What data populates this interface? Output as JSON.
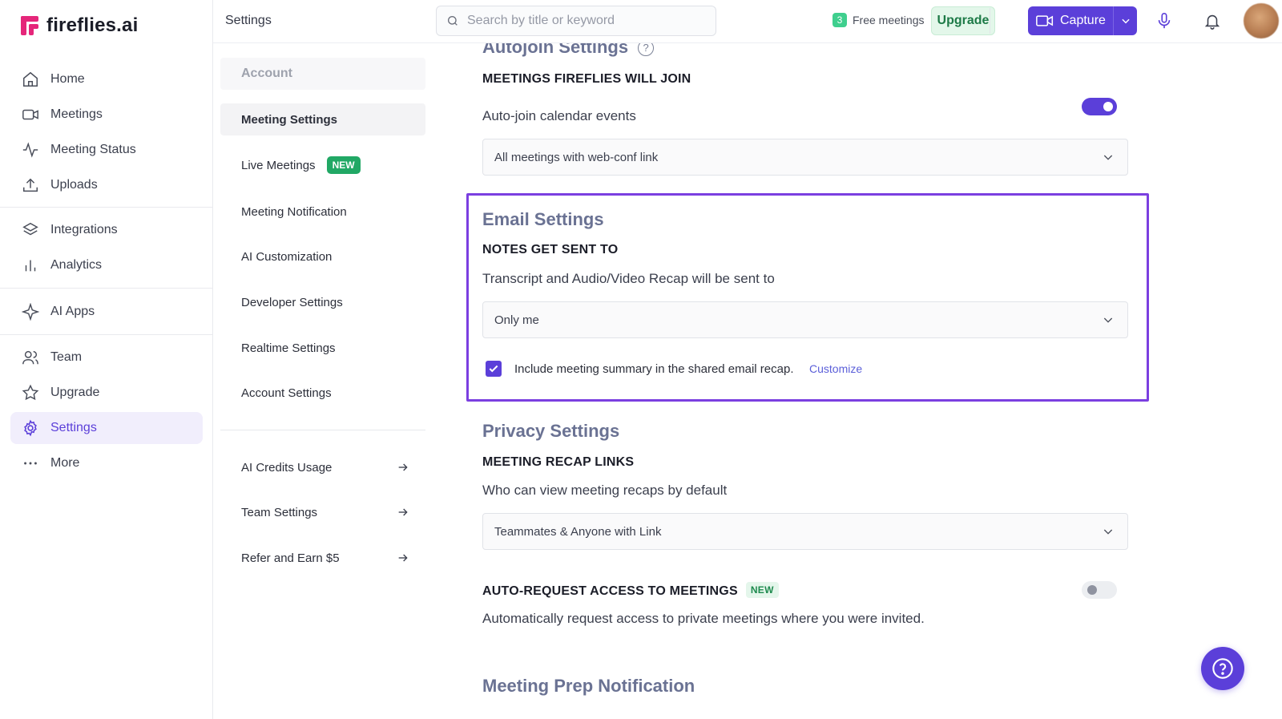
{
  "brand": {
    "name": "fireflies.ai",
    "logo_color": "#e5267a",
    "accent": "#5b3fd9"
  },
  "sidebar": {
    "items": [
      {
        "label": "Home",
        "icon": "home-icon"
      },
      {
        "label": "Meetings",
        "icon": "video-icon"
      },
      {
        "label": "Meeting Status",
        "icon": "pulse-icon"
      },
      {
        "label": "Uploads",
        "icon": "upload-icon"
      },
      {
        "label": "Integrations",
        "icon": "layers-icon"
      },
      {
        "label": "Analytics",
        "icon": "bar-chart-icon"
      },
      {
        "label": "AI Apps",
        "icon": "sparkle-icon"
      },
      {
        "label": "Team",
        "icon": "users-icon"
      },
      {
        "label": "Upgrade",
        "icon": "star-icon"
      },
      {
        "label": "Settings",
        "icon": "gear-icon",
        "active": true
      },
      {
        "label": "More",
        "icon": "more-dots-icon"
      }
    ]
  },
  "topbar": {
    "title": "Settings",
    "search_placeholder": "Search by title or keyword",
    "free_count": "3",
    "free_label": "Free meetings",
    "upgrade_label": "Upgrade",
    "capture_label": "Capture"
  },
  "subnav": {
    "account_header": "Account",
    "items": [
      {
        "label": "Meeting Settings",
        "active": true
      },
      {
        "label": "Live Meetings",
        "badge": "NEW"
      },
      {
        "label": "Meeting Notification"
      },
      {
        "label": "AI Customization"
      },
      {
        "label": "Developer Settings"
      },
      {
        "label": "Realtime Settings"
      },
      {
        "label": "Account Settings"
      }
    ],
    "links": [
      {
        "label": "AI Credits Usage"
      },
      {
        "label": "Team Settings"
      },
      {
        "label": "Refer and Earn $5"
      }
    ]
  },
  "main": {
    "autojoin": {
      "title": "Autojoin Settings",
      "help": "?",
      "heading": "MEETINGS FIREFLIES WILL JOIN",
      "toggle_label": "Auto-join calendar events",
      "toggle_on": true,
      "select_value": "All meetings with web-conf link"
    },
    "email": {
      "title": "Email Settings",
      "heading": "NOTES GET SENT TO",
      "description": "Transcript and Audio/Video Recap will be sent to",
      "select_value": "Only me",
      "checkbox_checked": true,
      "checkbox_label": "Include meeting summary in the shared email recap.",
      "customize_label": "Customize"
    },
    "privacy": {
      "title": "Privacy Settings",
      "heading": "MEETING RECAP LINKS",
      "description": "Who can view meeting recaps by default",
      "select_value": "Teammates & Anyone with Link",
      "auto_request_heading": "AUTO-REQUEST ACCESS TO MEETINGS",
      "auto_request_badge": "NEW",
      "auto_request_on": false,
      "auto_request_desc": "Automatically request access to private meetings where you were invited."
    },
    "prep": {
      "title": "Meeting Prep Notification"
    }
  }
}
